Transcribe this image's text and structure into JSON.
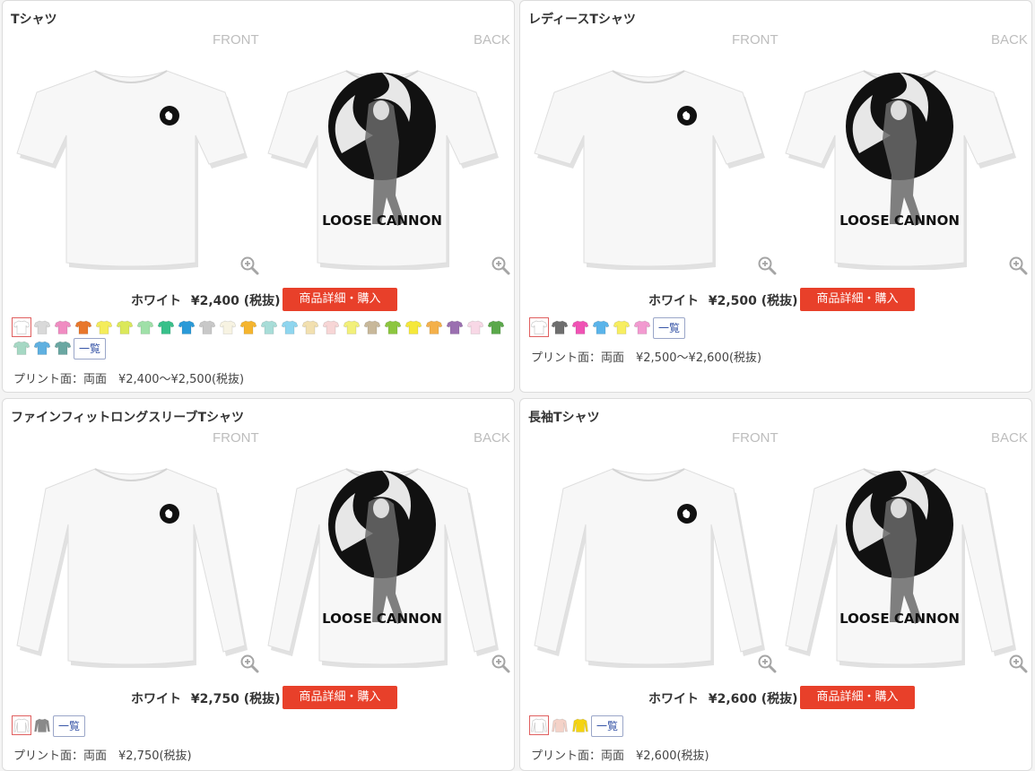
{
  "labels": {
    "front": "FRONT",
    "back": "BACK"
  },
  "design_text": "LOOSE CANNON",
  "products": [
    {
      "title": "Tシャツ",
      "color": "ホワイト",
      "price": "¥2,400 (税抜)",
      "buy_label": "商品詳細・購入",
      "list_label": "一覧",
      "print_info": "プリント面：両面　¥2,400〜¥2,500(税抜)",
      "sleeve": "short",
      "swatches": [
        "#ffffff",
        "#d9d9d9",
        "#f08cc2",
        "#e8772b",
        "#f4ec5a",
        "#dbe85a",
        "#9fe0a8",
        "#38c08a",
        "#2a9ad8",
        "#c8c8c8",
        "#f7f3e2",
        "#f5b52e",
        "#a8ddd8",
        "#8fd6ef",
        "#f2e0b0",
        "#f7d6d6",
        "#f2f07a",
        "#c8b89a",
        "#8cc63f",
        "#f5e83a",
        "#f4b04a",
        "#9a6fb0",
        "#f8d8e6",
        "#5aa84a",
        "#a6d8c4",
        "#5fb0e0",
        "#6aa7a2"
      ]
    },
    {
      "title": "レディースTシャツ",
      "color": "ホワイト",
      "price": "¥2,500 (税抜)",
      "buy_label": "商品詳細・購入",
      "list_label": "一覧",
      "print_info": "プリント面：両面　¥2,500〜¥2,600(税抜)",
      "sleeve": "short",
      "swatches": [
        "#ffffff",
        "#6e6e6e",
        "#f052b4",
        "#5ab4ea",
        "#f7ee60",
        "#f29ad0"
      ]
    },
    {
      "title": "ファインフィットロングスリーブTシャツ",
      "color": "ホワイト",
      "price": "¥2,750 (税抜)",
      "buy_label": "商品詳細・購入",
      "list_label": "一覧",
      "print_info": "プリント面：両面　¥2,750(税抜)",
      "sleeve": "long",
      "swatches": [
        "#ffffff",
        "#8a8a8a"
      ]
    },
    {
      "title": "長袖Tシャツ",
      "color": "ホワイト",
      "price": "¥2,600 (税抜)",
      "buy_label": "商品詳細・購入",
      "list_label": "一覧",
      "print_info": "プリント面：両面　¥2,600(税抜)",
      "sleeve": "long",
      "swatches": [
        "#ffffff",
        "#f4d2c8",
        "#f5d410"
      ]
    }
  ]
}
